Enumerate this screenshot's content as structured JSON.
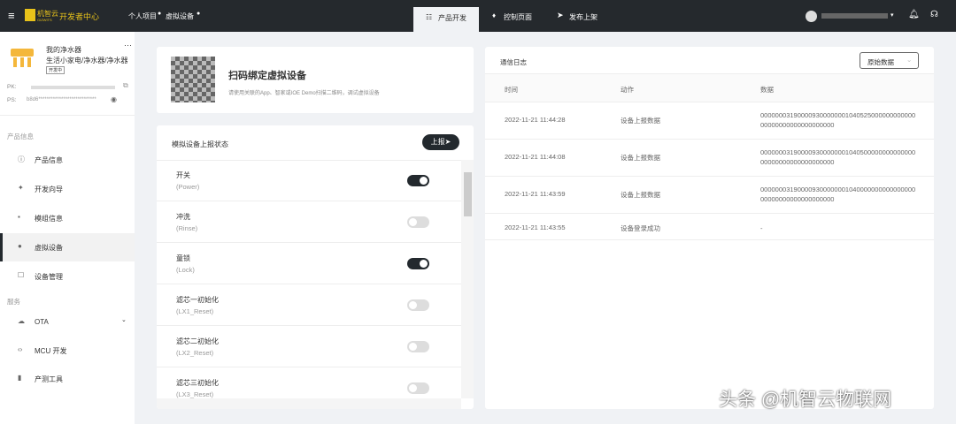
{
  "topbar": {
    "logo": "机智云",
    "logo_sub": "GIZWITS",
    "portal": "开发者中心",
    "breadcrumb": [
      "个人项目",
      "虚拟设备"
    ],
    "tabs": [
      "产品开发",
      "控制页面",
      "发布上架"
    ],
    "active_tab": 0
  },
  "product": {
    "name": "我的净水器",
    "category": "生活小家电/净水器/净水器",
    "status": "开发中",
    "pk_label": "PK:",
    "ps_label": "PS:",
    "ps_value": "b8d6****************************"
  },
  "sidebar": {
    "section1": "产品信息",
    "items1": [
      "产品信息",
      "开发向导",
      "模组信息",
      "虚拟设备",
      "设备管理"
    ],
    "active": "虚拟设备",
    "section2": "服务",
    "items2": [
      "OTA",
      "MCU 开发",
      "产测工具"
    ]
  },
  "bind": {
    "title": "扫码绑定虚拟设备",
    "desc": "请使用关联的App、智家或IOE Demo扫描二维码，调试虚拟设备"
  },
  "report": {
    "title": "模拟设备上报状态",
    "button": "上报➤",
    "items": [
      {
        "name": "开关",
        "id": "(Power)",
        "on": true
      },
      {
        "name": "冲洗",
        "id": "(Rinse)",
        "on": false
      },
      {
        "name": "童锁",
        "id": "(Lock)",
        "on": true
      },
      {
        "name": "滤芯一初始化",
        "id": "(LX1_Reset)",
        "on": false
      },
      {
        "name": "滤芯二初始化",
        "id": "(LX2_Reset)",
        "on": false
      },
      {
        "name": "滤芯三初始化",
        "id": "(LX3_Reset)",
        "on": false
      }
    ]
  },
  "log": {
    "title": "通信日志",
    "select": "原始数据",
    "headers": [
      "时间",
      "动作",
      "数据"
    ],
    "rows": [
      {
        "time": "2022-11-21 11:44:28",
        "action": "设备上报数据",
        "data1": "000000031900009300000001040525000000000000",
        "data2": "00000000000000000000"
      },
      {
        "time": "2022-11-21 11:44:08",
        "action": "设备上报数据",
        "data1": "000000031900009300000001040500000000000000",
        "data2": "00000000000000000000"
      },
      {
        "time": "2022-11-21 11:43:59",
        "action": "设备上报数据",
        "data1": "000000031900009300000001040000000000000000",
        "data2": "00000000000000000000"
      },
      {
        "time": "2022-11-21 11:43:55",
        "action": "设备登录成功",
        "data1": "-",
        "data2": ""
      }
    ]
  },
  "watermark": "头条 @机智云物联网"
}
